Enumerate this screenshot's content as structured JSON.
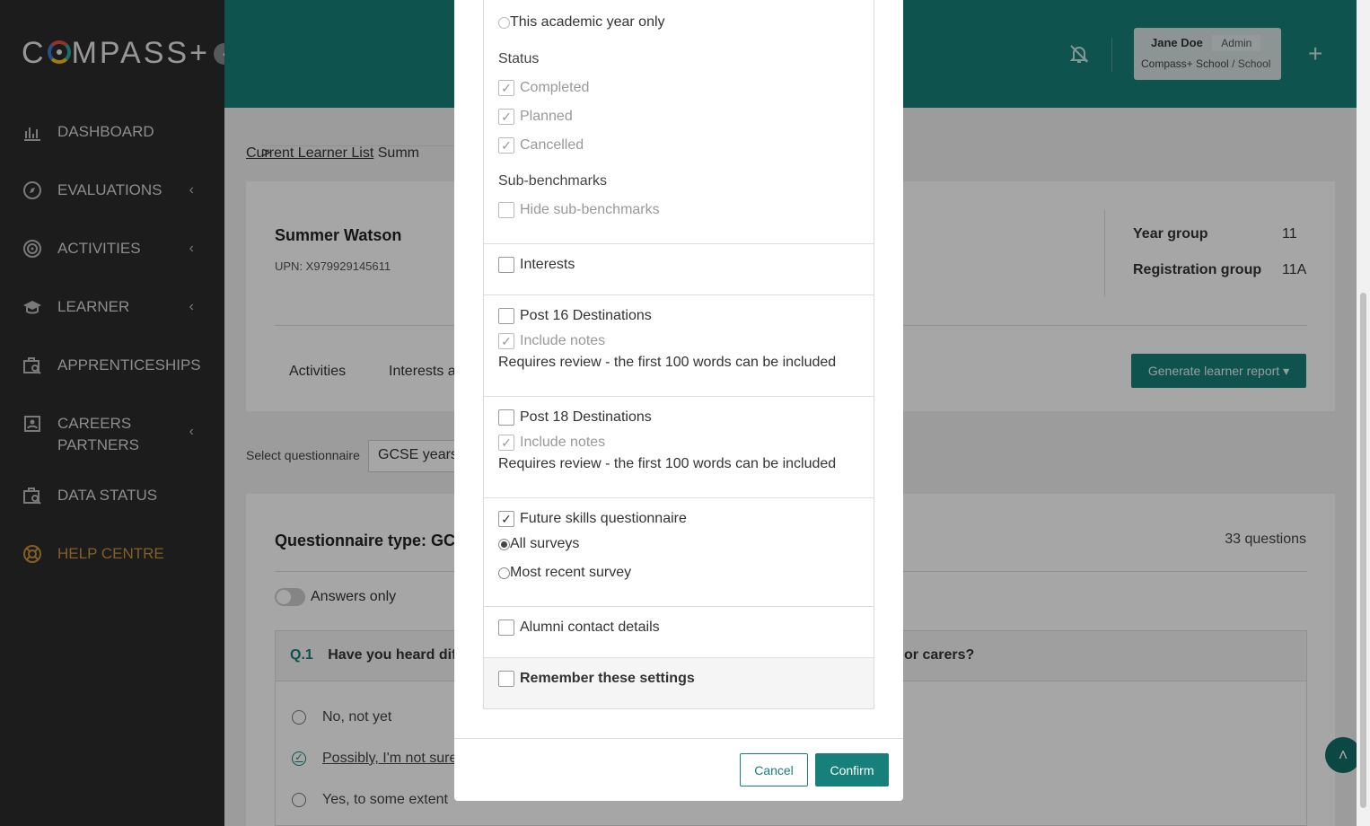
{
  "app": {
    "logo_text": "COMPASS+"
  },
  "sidebar": {
    "items": [
      {
        "label": "DASHBOARD",
        "icon": "chart-icon"
      },
      {
        "label": "EVALUATIONS",
        "icon": "compass-icon"
      },
      {
        "label": "ACTIVITIES",
        "icon": "target-icon"
      },
      {
        "label": "LEARNER",
        "icon": "graduation-cap-icon"
      },
      {
        "label": "APPRENTICESHIPS",
        "icon": "briefcase-search-icon"
      },
      {
        "label": "CAREERS PARTNERS",
        "icon": "id-card-icon"
      },
      {
        "label": "DATA STATUS",
        "icon": "briefcase-search-icon"
      },
      {
        "label": "HELP CENTRE",
        "icon": "lifebuoy-icon"
      }
    ]
  },
  "header": {
    "user_name": "Jane Doe",
    "user_role": "Admin",
    "school": "Compass+ School",
    "school_type": "/ School"
  },
  "breadcrumb": {
    "parent": "Current Learner List",
    "separator": ">",
    "current": "Summ"
  },
  "learner": {
    "name": "Summer Watson",
    "upn": "UPN: X979929145611",
    "year_group_label": "Year group",
    "year_group": "11",
    "reg_group_label": "Registration group",
    "reg_group": "11A"
  },
  "tabs": [
    "Activities",
    "Interests a"
  ],
  "generate_button": "Generate learner report ▾",
  "questionnaire": {
    "select_label": "Select questionnaire",
    "select_value": "GCSE years",
    "type_label": "Questionnaire type: GC",
    "count": "33 questions",
    "answers_only": "Answers only",
    "q_num": "Q.1",
    "q_text_start": "Have you heard dif",
    "q_text_end": "or carers?",
    "options": [
      "No, not yet",
      "Possibly, I'm not sure",
      "Yes, to some extent"
    ]
  },
  "modal": {
    "academic_year_option": "This academic year only",
    "status_label": "Status",
    "status_options": [
      "Completed",
      "Planned",
      "Cancelled"
    ],
    "sub_benchmarks_label": "Sub-benchmarks",
    "hide_sub_benchmarks": "Hide sub-benchmarks",
    "interests": "Interests",
    "post16": "Post 16 Destinations",
    "post18": "Post 18 Destinations",
    "include_notes": "Include notes",
    "review_note": "Requires review - the first 100 words can be included",
    "future_skills": "Future skills questionnaire",
    "all_surveys": "All surveys",
    "most_recent": "Most recent survey",
    "alumni": "Alumni contact details",
    "remember": "Remember these settings",
    "cancel": "Cancel",
    "confirm": "Confirm"
  },
  "colors": {
    "teal": "#17807a",
    "sidebar": "#2b2b2b",
    "help": "#c8923c"
  }
}
